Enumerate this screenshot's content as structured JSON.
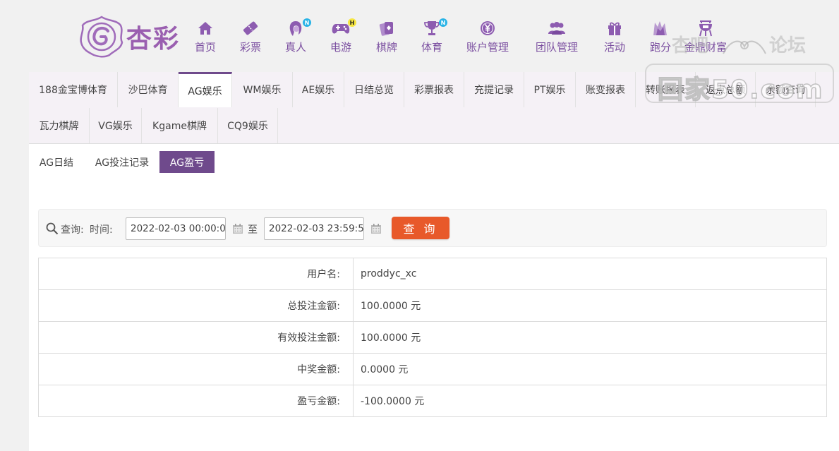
{
  "brand": {
    "logo_text": "杏彩",
    "color": "#9a5fb0"
  },
  "nav": [
    {
      "label": "首页",
      "icon": "home-icon"
    },
    {
      "label": "彩票",
      "icon": "lottery-ticket-icon"
    },
    {
      "label": "真人",
      "icon": "live-dealer-icon",
      "badge": "N"
    },
    {
      "label": "电游",
      "icon": "gamepad-icon",
      "badge": "H"
    },
    {
      "label": "棋牌",
      "icon": "cards-icon"
    },
    {
      "label": "体育",
      "icon": "trophy-icon",
      "badge": "N"
    },
    {
      "label": "账户管理",
      "icon": "yen-coin-icon"
    },
    {
      "label": "团队管理",
      "icon": "team-icon"
    },
    {
      "label": "活动",
      "icon": "gift-icon"
    },
    {
      "label": "跑分",
      "icon": "run-score-icon"
    },
    {
      "label": "金鼎财富",
      "icon": "tripod-icon"
    }
  ],
  "watermark": {
    "top_left": "杏吧",
    "top_right": "论坛",
    "main": "回家50.com"
  },
  "tabs_row1": [
    "188金宝博体育",
    "沙巴体育",
    "AG娱乐",
    "WM娱乐",
    "AE娱乐",
    "日结总览",
    "彩票报表",
    "充提记录",
    "PT娱乐",
    "账变报表",
    "转账报表",
    "返点总额",
    "余额查询"
  ],
  "tabs_row2": [
    "瓦力棋牌",
    "VG娱乐",
    "Kgame棋牌",
    "CQ9娱乐"
  ],
  "active_tab": "AG娱乐",
  "subtabs": [
    "AG日结",
    "AG投注记录",
    "AG盈亏"
  ],
  "active_subtab": "AG盈亏",
  "query": {
    "search_label": "查询:",
    "time_label": "时间:",
    "start": "2022-02-03 00:00:00",
    "to_label": "至",
    "end": "2022-02-03 23:59:59",
    "button": "查 询"
  },
  "results": [
    {
      "key": "用户名:",
      "value": "proddyc_xc"
    },
    {
      "key": "总投注金额:",
      "value": "100.0000 元"
    },
    {
      "key": "有效投注金额:",
      "value": "100.0000 元"
    },
    {
      "key": "中奖金额:",
      "value": "0.0000 元"
    },
    {
      "key": "盈亏金额:",
      "value": "-100.0000 元"
    }
  ],
  "colors": {
    "accent": "#6f4a8c",
    "button": "#e8592a",
    "nav": "#7b4fa0"
  }
}
